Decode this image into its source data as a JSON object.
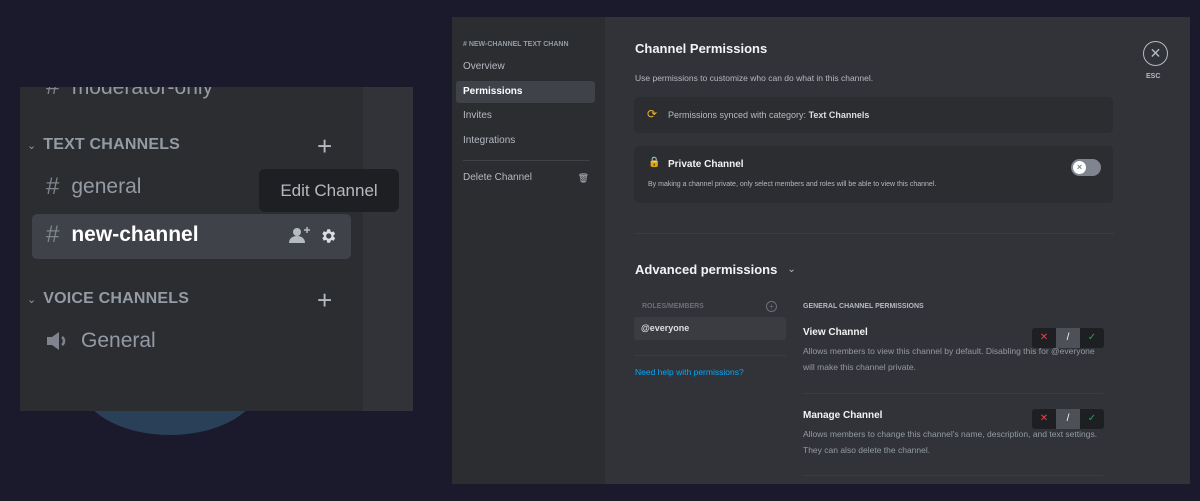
{
  "channel_list": {
    "cut_channel": "moderator-only",
    "text_category": "TEXT CHANNELS",
    "voice_category": "VOICE CHANNELS",
    "text_channels": [
      "general",
      "new-channel"
    ],
    "voice_channels": [
      "General"
    ],
    "tooltip": "Edit Channel"
  },
  "settings": {
    "sidebar_header": "# NEW-CHANNEL TEXT CHANN",
    "items": [
      "Overview",
      "Permissions",
      "Invites",
      "Integrations"
    ],
    "delete": "Delete Channel",
    "esc": "ESC"
  },
  "content": {
    "title": "Channel Permissions",
    "subtitle": "Use permissions to customize who can do what in this channel.",
    "synced_prefix": "Permissions synced with category:",
    "synced_category": "Text Channels",
    "private_title": "Private Channel",
    "private_desc": "By making a channel private, only select members and roles will be able to view this channel.",
    "private_enabled": false,
    "advanced": "Advanced permissions",
    "roles_header": "ROLES/MEMBERS",
    "roles": [
      "@everyone"
    ],
    "help_link": "Need help with permissions?",
    "perm_header": "GENERAL CHANNEL PERMISSIONS",
    "permissions": [
      {
        "name": "View Channel",
        "desc": "Allows members to view this channel by default. Disabling this for @everyone will make this channel private.",
        "state": "neutral"
      },
      {
        "name": "Manage Channel",
        "desc": "Allows members to change this channel's name, description, and text settings. They can also delete the channel.",
        "state": "neutral"
      }
    ]
  },
  "colors": {
    "accent_link": "#00a8fc",
    "deny": "#f23f43",
    "allow": "#23a55a",
    "sync": "#f0b232"
  }
}
